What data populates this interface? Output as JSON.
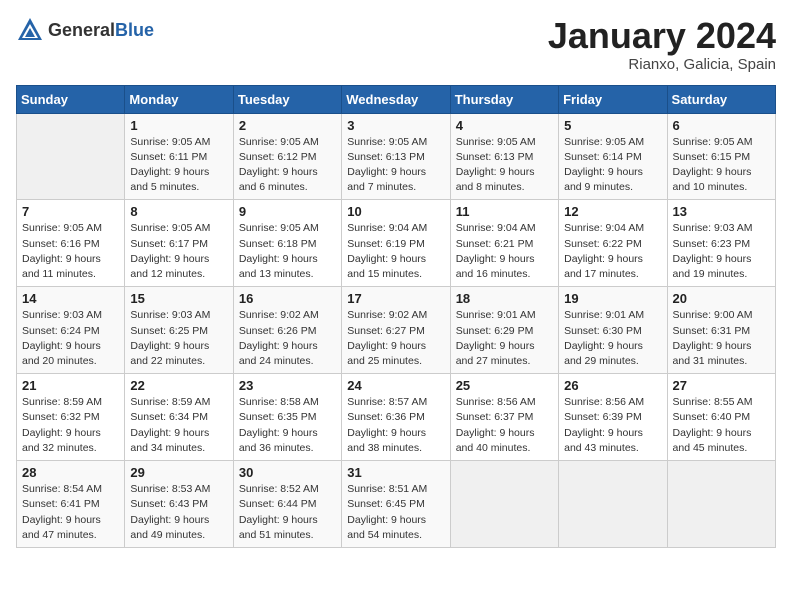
{
  "header": {
    "logo_general": "General",
    "logo_blue": "Blue",
    "month_title": "January 2024",
    "location": "Rianxo, Galicia, Spain"
  },
  "columns": [
    "Sunday",
    "Monday",
    "Tuesday",
    "Wednesday",
    "Thursday",
    "Friday",
    "Saturday"
  ],
  "weeks": [
    [
      {
        "day": "",
        "sunrise": "",
        "sunset": "",
        "daylight": ""
      },
      {
        "day": "1",
        "sunrise": "Sunrise: 9:05 AM",
        "sunset": "Sunset: 6:11 PM",
        "daylight": "Daylight: 9 hours and 5 minutes."
      },
      {
        "day": "2",
        "sunrise": "Sunrise: 9:05 AM",
        "sunset": "Sunset: 6:12 PM",
        "daylight": "Daylight: 9 hours and 6 minutes."
      },
      {
        "day": "3",
        "sunrise": "Sunrise: 9:05 AM",
        "sunset": "Sunset: 6:13 PM",
        "daylight": "Daylight: 9 hours and 7 minutes."
      },
      {
        "day": "4",
        "sunrise": "Sunrise: 9:05 AM",
        "sunset": "Sunset: 6:13 PM",
        "daylight": "Daylight: 9 hours and 8 minutes."
      },
      {
        "day": "5",
        "sunrise": "Sunrise: 9:05 AM",
        "sunset": "Sunset: 6:14 PM",
        "daylight": "Daylight: 9 hours and 9 minutes."
      },
      {
        "day": "6",
        "sunrise": "Sunrise: 9:05 AM",
        "sunset": "Sunset: 6:15 PM",
        "daylight": "Daylight: 9 hours and 10 minutes."
      }
    ],
    [
      {
        "day": "7",
        "sunrise": "Sunrise: 9:05 AM",
        "sunset": "Sunset: 6:16 PM",
        "daylight": "Daylight: 9 hours and 11 minutes."
      },
      {
        "day": "8",
        "sunrise": "Sunrise: 9:05 AM",
        "sunset": "Sunset: 6:17 PM",
        "daylight": "Daylight: 9 hours and 12 minutes."
      },
      {
        "day": "9",
        "sunrise": "Sunrise: 9:05 AM",
        "sunset": "Sunset: 6:18 PM",
        "daylight": "Daylight: 9 hours and 13 minutes."
      },
      {
        "day": "10",
        "sunrise": "Sunrise: 9:04 AM",
        "sunset": "Sunset: 6:19 PM",
        "daylight": "Daylight: 9 hours and 15 minutes."
      },
      {
        "day": "11",
        "sunrise": "Sunrise: 9:04 AM",
        "sunset": "Sunset: 6:21 PM",
        "daylight": "Daylight: 9 hours and 16 minutes."
      },
      {
        "day": "12",
        "sunrise": "Sunrise: 9:04 AM",
        "sunset": "Sunset: 6:22 PM",
        "daylight": "Daylight: 9 hours and 17 minutes."
      },
      {
        "day": "13",
        "sunrise": "Sunrise: 9:03 AM",
        "sunset": "Sunset: 6:23 PM",
        "daylight": "Daylight: 9 hours and 19 minutes."
      }
    ],
    [
      {
        "day": "14",
        "sunrise": "Sunrise: 9:03 AM",
        "sunset": "Sunset: 6:24 PM",
        "daylight": "Daylight: 9 hours and 20 minutes."
      },
      {
        "day": "15",
        "sunrise": "Sunrise: 9:03 AM",
        "sunset": "Sunset: 6:25 PM",
        "daylight": "Daylight: 9 hours and 22 minutes."
      },
      {
        "day": "16",
        "sunrise": "Sunrise: 9:02 AM",
        "sunset": "Sunset: 6:26 PM",
        "daylight": "Daylight: 9 hours and 24 minutes."
      },
      {
        "day": "17",
        "sunrise": "Sunrise: 9:02 AM",
        "sunset": "Sunset: 6:27 PM",
        "daylight": "Daylight: 9 hours and 25 minutes."
      },
      {
        "day": "18",
        "sunrise": "Sunrise: 9:01 AM",
        "sunset": "Sunset: 6:29 PM",
        "daylight": "Daylight: 9 hours and 27 minutes."
      },
      {
        "day": "19",
        "sunrise": "Sunrise: 9:01 AM",
        "sunset": "Sunset: 6:30 PM",
        "daylight": "Daylight: 9 hours and 29 minutes."
      },
      {
        "day": "20",
        "sunrise": "Sunrise: 9:00 AM",
        "sunset": "Sunset: 6:31 PM",
        "daylight": "Daylight: 9 hours and 31 minutes."
      }
    ],
    [
      {
        "day": "21",
        "sunrise": "Sunrise: 8:59 AM",
        "sunset": "Sunset: 6:32 PM",
        "daylight": "Daylight: 9 hours and 32 minutes."
      },
      {
        "day": "22",
        "sunrise": "Sunrise: 8:59 AM",
        "sunset": "Sunset: 6:34 PM",
        "daylight": "Daylight: 9 hours and 34 minutes."
      },
      {
        "day": "23",
        "sunrise": "Sunrise: 8:58 AM",
        "sunset": "Sunset: 6:35 PM",
        "daylight": "Daylight: 9 hours and 36 minutes."
      },
      {
        "day": "24",
        "sunrise": "Sunrise: 8:57 AM",
        "sunset": "Sunset: 6:36 PM",
        "daylight": "Daylight: 9 hours and 38 minutes."
      },
      {
        "day": "25",
        "sunrise": "Sunrise: 8:56 AM",
        "sunset": "Sunset: 6:37 PM",
        "daylight": "Daylight: 9 hours and 40 minutes."
      },
      {
        "day": "26",
        "sunrise": "Sunrise: 8:56 AM",
        "sunset": "Sunset: 6:39 PM",
        "daylight": "Daylight: 9 hours and 43 minutes."
      },
      {
        "day": "27",
        "sunrise": "Sunrise: 8:55 AM",
        "sunset": "Sunset: 6:40 PM",
        "daylight": "Daylight: 9 hours and 45 minutes."
      }
    ],
    [
      {
        "day": "28",
        "sunrise": "Sunrise: 8:54 AM",
        "sunset": "Sunset: 6:41 PM",
        "daylight": "Daylight: 9 hours and 47 minutes."
      },
      {
        "day": "29",
        "sunrise": "Sunrise: 8:53 AM",
        "sunset": "Sunset: 6:43 PM",
        "daylight": "Daylight: 9 hours and 49 minutes."
      },
      {
        "day": "30",
        "sunrise": "Sunrise: 8:52 AM",
        "sunset": "Sunset: 6:44 PM",
        "daylight": "Daylight: 9 hours and 51 minutes."
      },
      {
        "day": "31",
        "sunrise": "Sunrise: 8:51 AM",
        "sunset": "Sunset: 6:45 PM",
        "daylight": "Daylight: 9 hours and 54 minutes."
      },
      {
        "day": "",
        "sunrise": "",
        "sunset": "",
        "daylight": ""
      },
      {
        "day": "",
        "sunrise": "",
        "sunset": "",
        "daylight": ""
      },
      {
        "day": "",
        "sunrise": "",
        "sunset": "",
        "daylight": ""
      }
    ]
  ]
}
